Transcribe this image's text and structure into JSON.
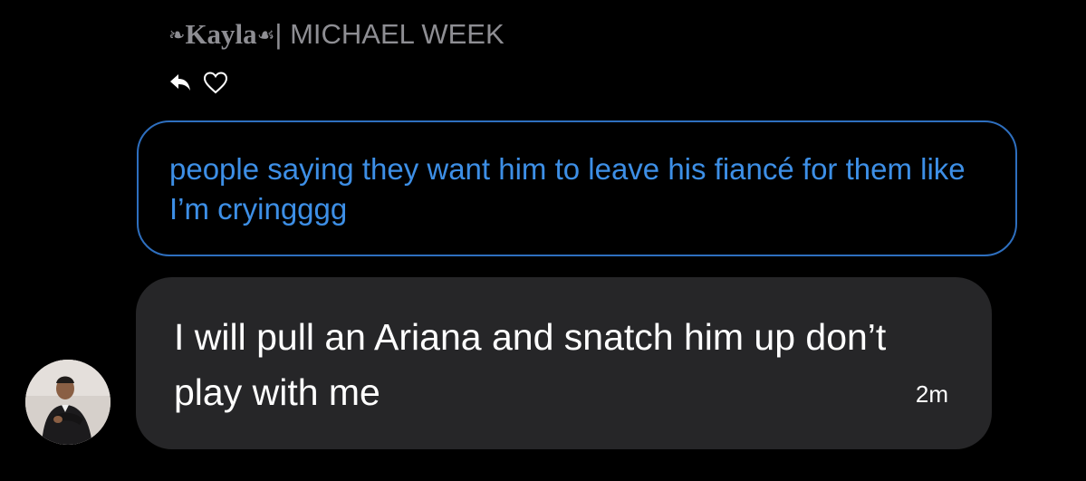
{
  "reply_header": {
    "flourish_left": "❧",
    "name": "Kayla",
    "flourish_right": "☙",
    "separator": "|",
    "suffix": " MICHAEL WEEK"
  },
  "actions": {
    "icons": [
      "reply-arrow-icon",
      "heart-outline-icon"
    ]
  },
  "quoted_message": {
    "text": "people saying they want him to leave his fiancé for them like I’m cryingggg"
  },
  "message": {
    "text": "I will pull an Ariana and snatch him up don’t play with me",
    "timestamp": "2m"
  },
  "colors": {
    "background": "#000000",
    "quoted_border": "#2e6fbf",
    "quoted_text": "#3d8fe6",
    "bubble": "#262628",
    "muted": "#8e8e93"
  }
}
